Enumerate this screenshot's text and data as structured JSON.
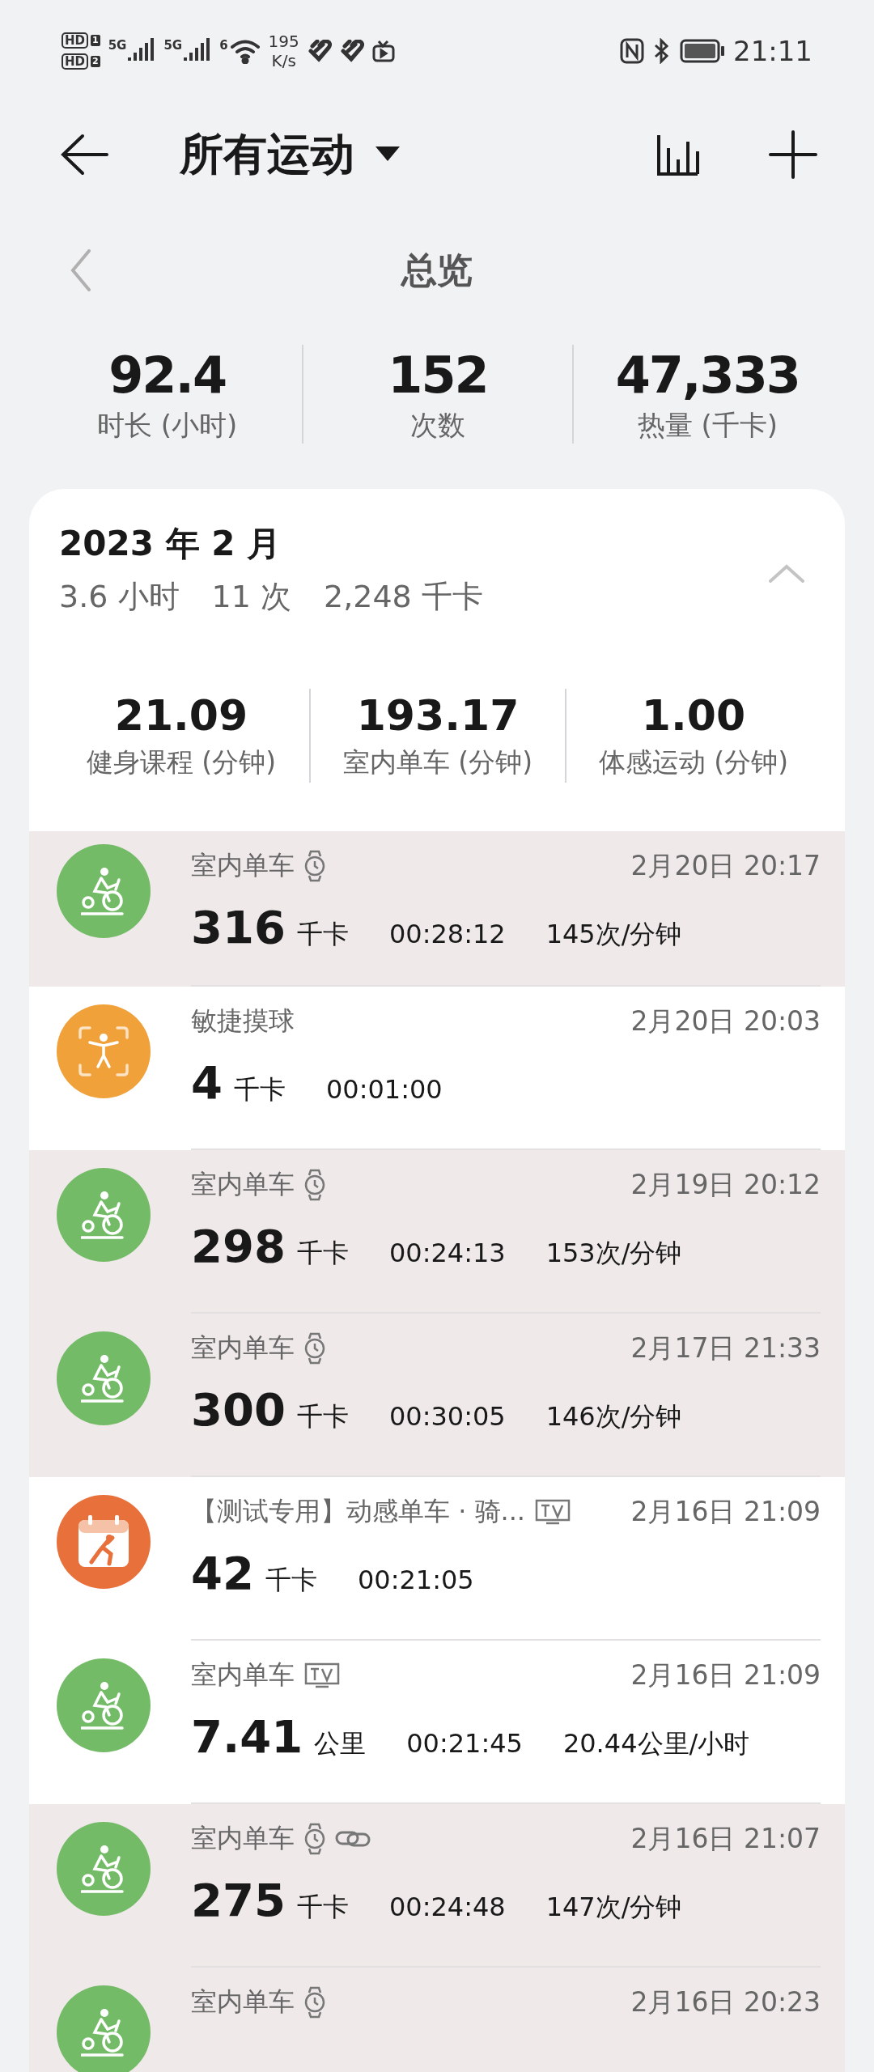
{
  "status_bar": {
    "sims": [
      {
        "badge": "HD",
        "slot": "1"
      },
      {
        "badge": "HD",
        "slot": "2"
      }
    ],
    "networks": [
      {
        "label": "5G"
      },
      {
        "label": "5G"
      }
    ],
    "wifi_label": "6",
    "speed": "195",
    "speed_unit": "K/s",
    "time": "21:11"
  },
  "header": {
    "title": "所有运动"
  },
  "overview": {
    "label": "总览",
    "stats": [
      {
        "value": "92.4",
        "label": "时长 (小时)"
      },
      {
        "value": "152",
        "label": "次数"
      },
      {
        "value": "47,333",
        "label": "热量 (千卡)"
      }
    ]
  },
  "month": {
    "title": "2023 年 2 月",
    "expanded": true,
    "summary": [
      "3.6 小时",
      "11 次",
      "2,248 千卡"
    ],
    "categories": [
      {
        "value": "21.09",
        "label": "健身课程 (分钟)"
      },
      {
        "value": "193.17",
        "label": "室内单车 (分钟)"
      },
      {
        "value": "1.00",
        "label": "体感运动 (分钟)"
      }
    ]
  },
  "records": [
    {
      "kind": "cycling",
      "shaded": true,
      "title": "室内单车",
      "badges": [
        {
          "kind": "watch"
        }
      ],
      "date": "2月20日 20:17",
      "value": "316",
      "unit": "千卡",
      "duration": "00:28:12",
      "rate": "145次/分钟"
    },
    {
      "kind": "agility",
      "shaded": false,
      "title": "敏捷摸球",
      "date": "2月20日 20:03",
      "value": "4",
      "unit": "千卡",
      "duration": "00:01:00"
    },
    {
      "kind": "cycling",
      "shaded": true,
      "title": "室内单车",
      "badges": [
        {
          "kind": "watch"
        }
      ],
      "date": "2月19日 20:12",
      "value": "298",
      "unit": "千卡",
      "duration": "00:24:13",
      "rate": "153次/分钟"
    },
    {
      "kind": "cycling",
      "shaded": true,
      "title": "室内单车",
      "badges": [
        {
          "kind": "watch"
        }
      ],
      "date": "2月17日 21:33",
      "value": "300",
      "unit": "千卡",
      "duration": "00:30:05",
      "rate": "146次/分钟"
    },
    {
      "kind": "course",
      "shaded": false,
      "title": "【测试专用】动感单车 · 骑...",
      "badges": [
        {
          "kind": "tv"
        }
      ],
      "date": "2月16日 21:09",
      "value": "42",
      "unit": "千卡",
      "duration": "00:21:05"
    },
    {
      "kind": "cycling",
      "shaded": false,
      "title": "室内单车",
      "badges": [
        {
          "kind": "tv"
        }
      ],
      "date": "2月16日 21:09",
      "value": "7.41",
      "unit": "公里",
      "duration": "00:21:45",
      "rate": "20.44公里/小时"
    },
    {
      "kind": "cycling",
      "shaded": true,
      "title": "室内单车",
      "badges": [
        {
          "kind": "watch"
        },
        {
          "kind": "link"
        }
      ],
      "date": "2月16日 21:07",
      "value": "275",
      "unit": "千卡",
      "duration": "00:24:48",
      "rate": "147次/分钟"
    },
    {
      "kind": "cycling",
      "shaded": true,
      "title": "室内单车",
      "badges": [
        {
          "kind": "watch"
        }
      ],
      "date": "2月16日 20:23"
    }
  ]
}
